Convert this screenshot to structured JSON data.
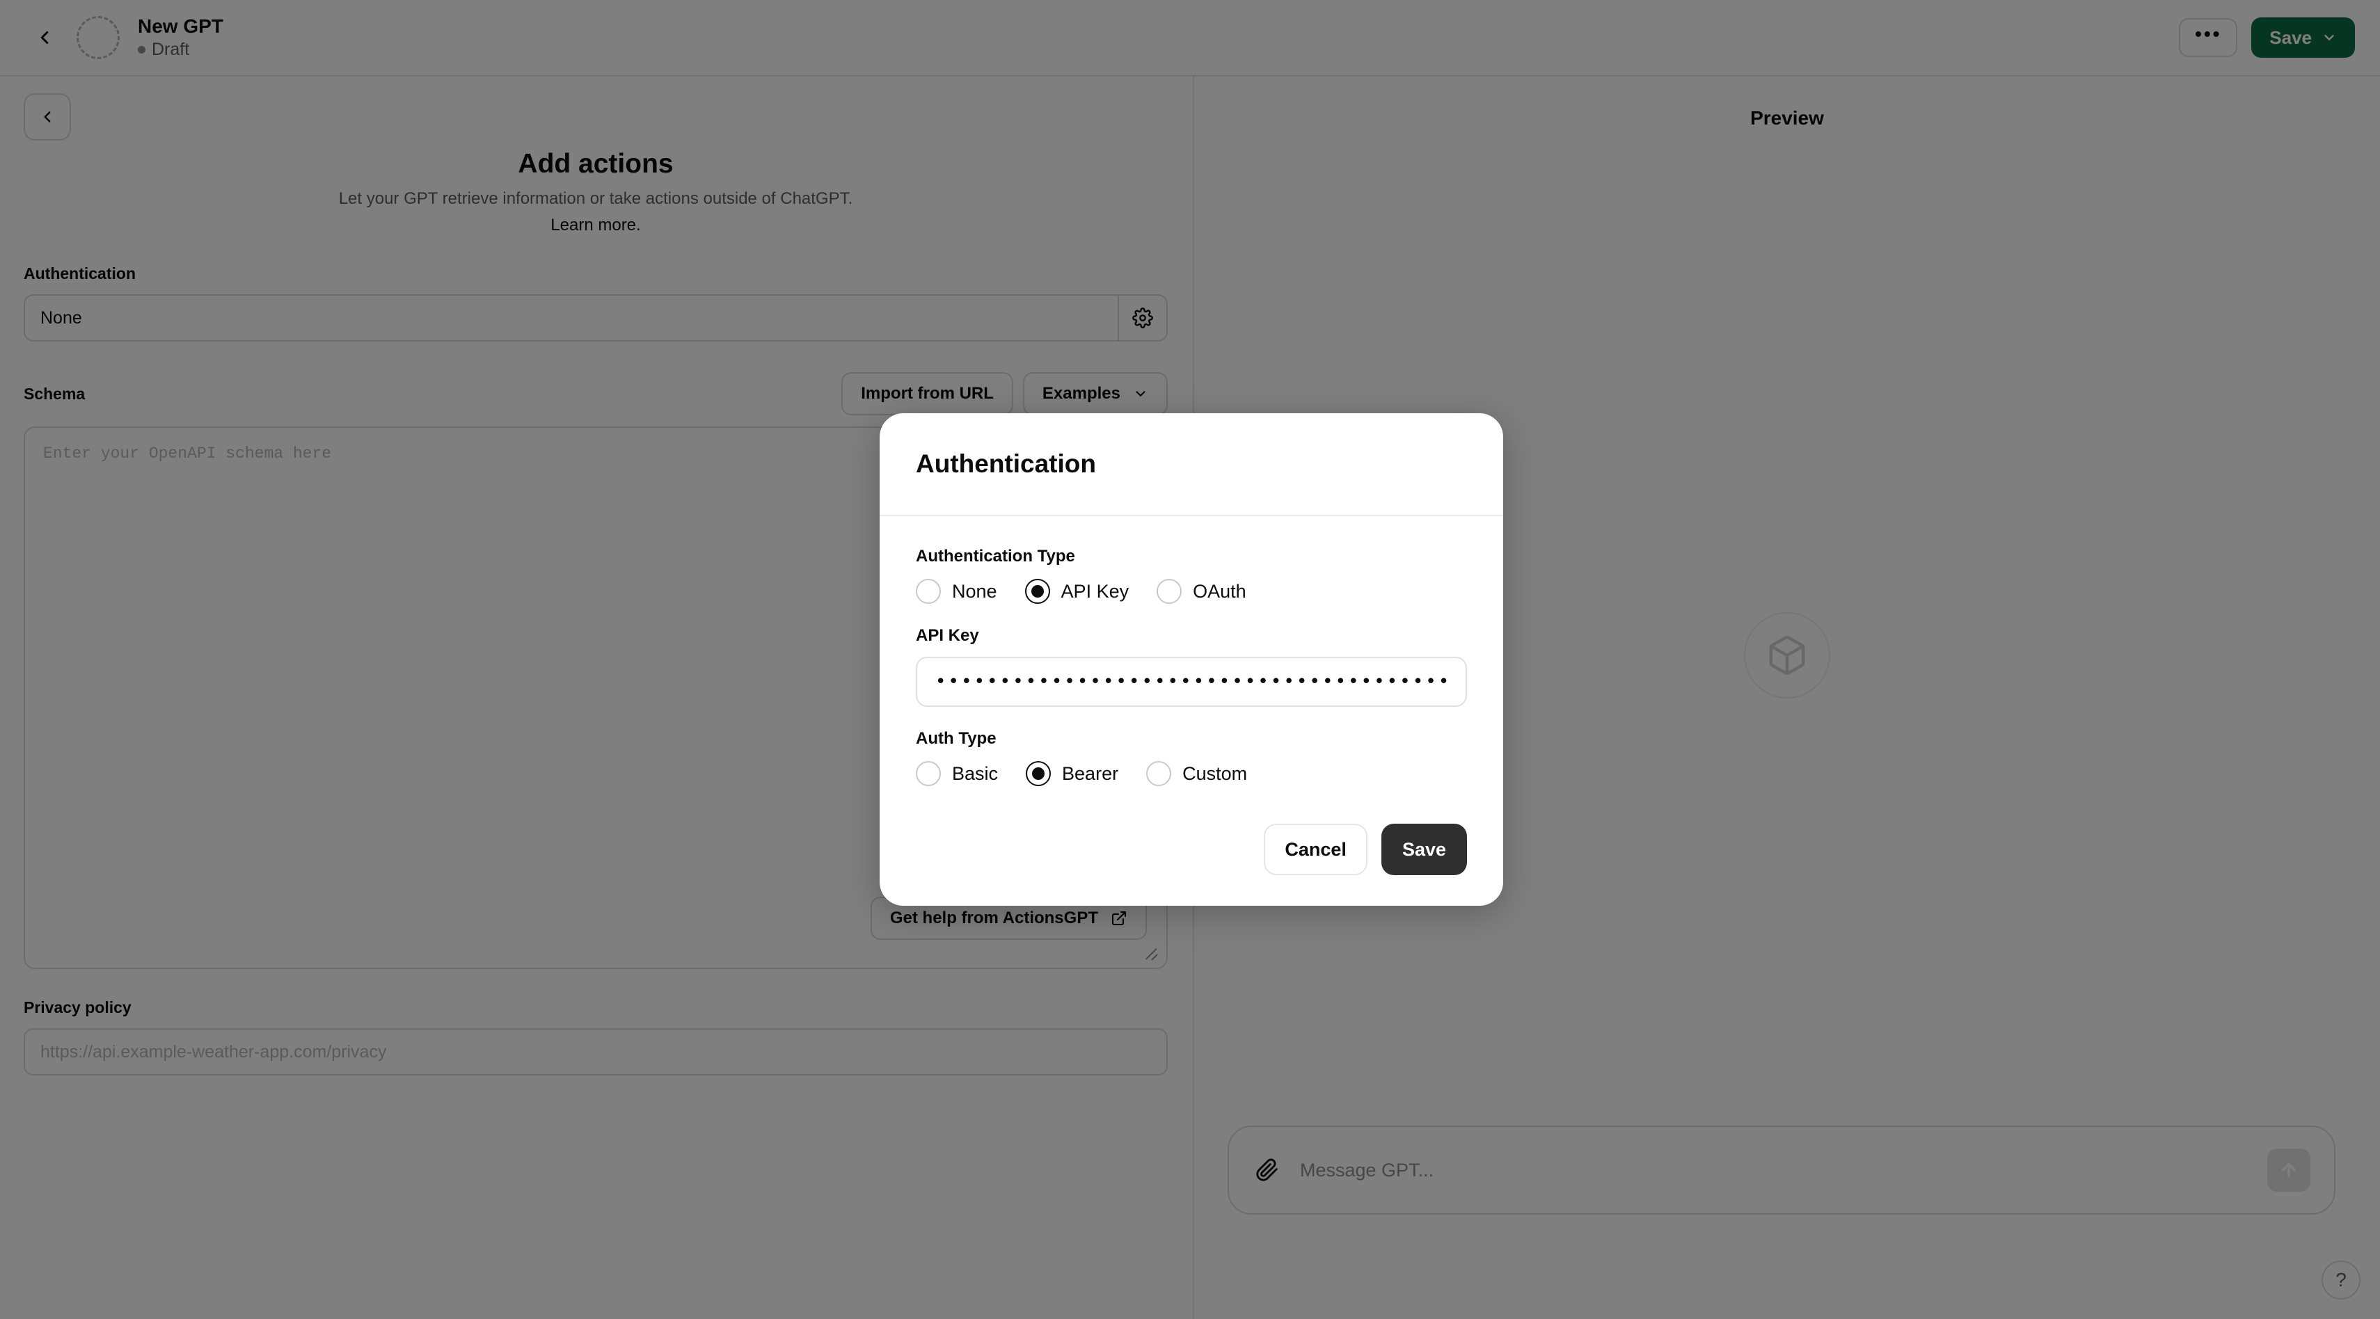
{
  "header": {
    "back_icon": "chevron-left-icon",
    "gpt_name": "New GPT",
    "status": "Draft",
    "more_label": "•••",
    "save_label": "Save",
    "save_color": "#0e6b47"
  },
  "left": {
    "back_icon": "chevron-left-icon",
    "page_title": "Add actions",
    "page_subtitle": "Let your GPT retrieve information or take actions outside of ChatGPT.",
    "learn_more": "Learn more.",
    "auth_section_label": "Authentication",
    "auth_value": "None",
    "auth_gear_icon": "gear-icon",
    "schema_section_label": "Schema",
    "import_label": "Import from URL",
    "examples_label": "Examples",
    "examples_chevron": "chevron-down-icon",
    "schema_placeholder": "Enter your OpenAPI schema here",
    "actionsgpt_label": "Get help from ActionsGPT",
    "actionsgpt_icon": "external-link-icon",
    "privacy_section_label": "Privacy policy",
    "privacy_placeholder": "https://api.example-weather-app.com/privacy"
  },
  "preview": {
    "title": "Preview",
    "placeholder_icon": "cube-icon",
    "composer_attach_icon": "paperclip-icon",
    "composer_placeholder": "Message GPT...",
    "composer_send_icon": "arrow-up-icon",
    "help_label": "?"
  },
  "modal": {
    "title": "Authentication",
    "auth_type_label": "Authentication Type",
    "auth_type_options": [
      {
        "label": "None",
        "checked": false
      },
      {
        "label": "API Key",
        "checked": true
      },
      {
        "label": "OAuth",
        "checked": false
      }
    ],
    "api_key_label": "API Key",
    "api_key_value": "•••••••••••••••••••••••••••••••••••••••••••••••",
    "auth_subtype_label": "Auth Type",
    "auth_subtype_options": [
      {
        "label": "Basic",
        "checked": false
      },
      {
        "label": "Bearer",
        "checked": true
      },
      {
        "label": "Custom",
        "checked": false
      }
    ],
    "cancel_label": "Cancel",
    "save_label": "Save"
  }
}
